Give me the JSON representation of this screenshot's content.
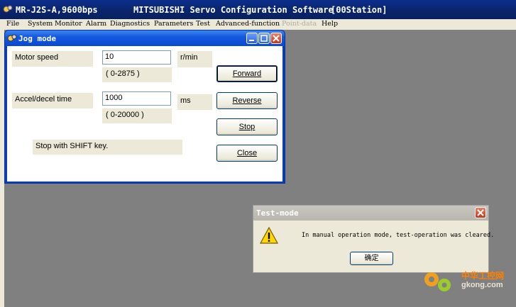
{
  "app": {
    "title_part1": "MR-J2S-A,9600bps",
    "title_part2": "MITSUBISHI Servo Configuration Software",
    "title_part3": "[00Station]"
  },
  "menu": [
    {
      "label": "File",
      "disabled": false
    },
    {
      "label": "System",
      "disabled": false
    },
    {
      "label": "Monitor",
      "disabled": false
    },
    {
      "label": "Alarm",
      "disabled": false
    },
    {
      "label": "Diagnostics",
      "disabled": false
    },
    {
      "label": "Parameters",
      "disabled": false
    },
    {
      "label": "Test",
      "disabled": false
    },
    {
      "label": "Advanced-function",
      "disabled": false
    },
    {
      "label": "Point-data",
      "disabled": true
    },
    {
      "label": "Help",
      "disabled": false
    }
  ],
  "jog": {
    "title": "Jog mode",
    "motor_speed_label": "Motor speed",
    "motor_speed_value": "10",
    "motor_speed_unit": "r/min",
    "motor_speed_range": "( 0-2875 )",
    "accel_label": "Accel/decel time",
    "accel_value": "1000",
    "accel_unit": "ms",
    "accel_range": "( 0-20000 )",
    "hint": "Stop with SHIFT key.",
    "buttons": {
      "forward": "Forward",
      "reverse": "Reverse",
      "stop": "Stop",
      "close": "Close"
    }
  },
  "dialog": {
    "title": "Test-mode",
    "message": "In manual operation mode, test-operation was cleared.",
    "ok_label": "确定",
    "icon": "warning-icon"
  },
  "watermark": {
    "cn": "中华工控网",
    "url": "gkong.com"
  },
  "colors": {
    "titlebar": "#0a246a",
    "xp_blue": "#1659e0",
    "dialog_bg": "#ece9d8",
    "desktop": "#808080"
  }
}
